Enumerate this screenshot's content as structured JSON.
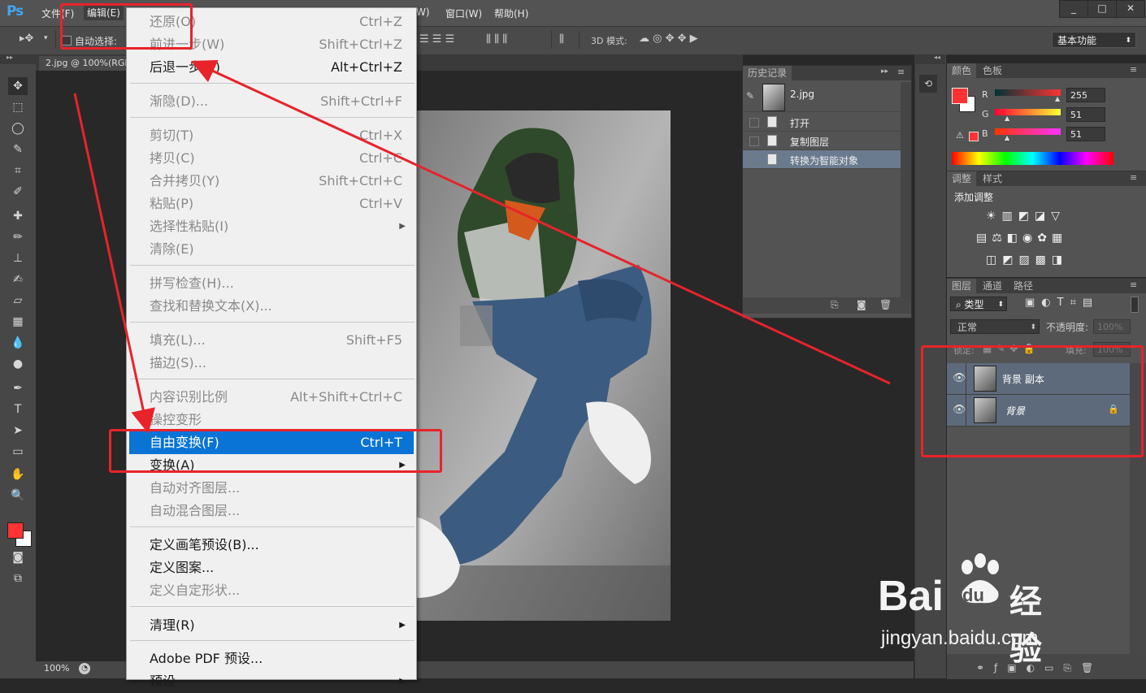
{
  "app": {
    "logo": "Ps"
  },
  "menubar": {
    "file": "文件(F)",
    "edit": "编辑(E)",
    "view_partial": "W)",
    "window": "窗口(W)",
    "help": "帮助(H)"
  },
  "options_bar": {
    "auto_select": "自动选择:",
    "mode_3d": "3D 模式:",
    "workspace": "基本功能"
  },
  "document": {
    "tab": "2.jpg @ 100%(RGB"
  },
  "status": {
    "zoom": "100%"
  },
  "edit_menu": {
    "items": [
      {
        "label": "还原(O)",
        "shortcut": "Ctrl+Z"
      },
      {
        "label": "前进一步(W)",
        "shortcut": "Shift+Ctrl+Z"
      },
      {
        "label": "后退一步(K)",
        "shortcut": "Alt+Ctrl+Z"
      },
      {
        "label": "渐隐(D)...",
        "shortcut": "Shift+Ctrl+F"
      },
      {
        "label": "剪切(T)",
        "shortcut": "Ctrl+X"
      },
      {
        "label": "拷贝(C)",
        "shortcut": "Ctrl+C"
      },
      {
        "label": "合并拷贝(Y)",
        "shortcut": "Shift+Ctrl+C"
      },
      {
        "label": "粘贴(P)",
        "shortcut": "Ctrl+V"
      },
      {
        "label": "选择性粘贴(I)",
        "shortcut": ""
      },
      {
        "label": "清除(E)",
        "shortcut": ""
      },
      {
        "label": "拼写检查(H)...",
        "shortcut": ""
      },
      {
        "label": "查找和替换文本(X)...",
        "shortcut": ""
      },
      {
        "label": "填充(L)...",
        "shortcut": "Shift+F5"
      },
      {
        "label": "描边(S)...",
        "shortcut": ""
      },
      {
        "label": "内容识别比例",
        "shortcut": "Alt+Shift+Ctrl+C"
      },
      {
        "label": "操控变形",
        "shortcut": ""
      },
      {
        "label": "自由变换(F)",
        "shortcut": "Ctrl+T"
      },
      {
        "label": "变换(A)",
        "shortcut": ""
      },
      {
        "label": "自动对齐图层...",
        "shortcut": ""
      },
      {
        "label": "自动混合图层...",
        "shortcut": ""
      },
      {
        "label": "定义画笔预设(B)...",
        "shortcut": ""
      },
      {
        "label": "定义图案...",
        "shortcut": ""
      },
      {
        "label": "定义自定形状...",
        "shortcut": ""
      },
      {
        "label": "清理(R)",
        "shortcut": ""
      },
      {
        "label": "Adobe PDF 预设...",
        "shortcut": ""
      },
      {
        "label": "预设",
        "shortcut": ""
      }
    ]
  },
  "history_panel": {
    "title": "历史记录",
    "snapshot": "2.jpg",
    "steps": [
      "打开",
      "复制图层",
      "转换为智能对象"
    ]
  },
  "color_panel": {
    "tabs": [
      "颜色",
      "色板"
    ],
    "r_label": "R",
    "g_label": "G",
    "b_label": "B",
    "r": "255",
    "g": "51",
    "b": "51",
    "foreground": "#ff3333"
  },
  "adjust_panel": {
    "tabs": [
      "调整",
      "样式"
    ],
    "add_label": "添加调整"
  },
  "layers_panel": {
    "tabs": [
      "图层",
      "通道",
      "路径"
    ],
    "filter": "类型",
    "blend_mode": "正常",
    "opacity_label": "不透明度:",
    "opacity": "100%",
    "lock_label": "锁定:",
    "fill_label": "填充:",
    "fill": "100%",
    "layers": [
      {
        "name": "背景 副本"
      },
      {
        "name": "背景"
      }
    ]
  },
  "watermark": {
    "brand": "Bai",
    "brand2": "du",
    "brand3": "经验",
    "url": "jingyan.baidu.com"
  }
}
